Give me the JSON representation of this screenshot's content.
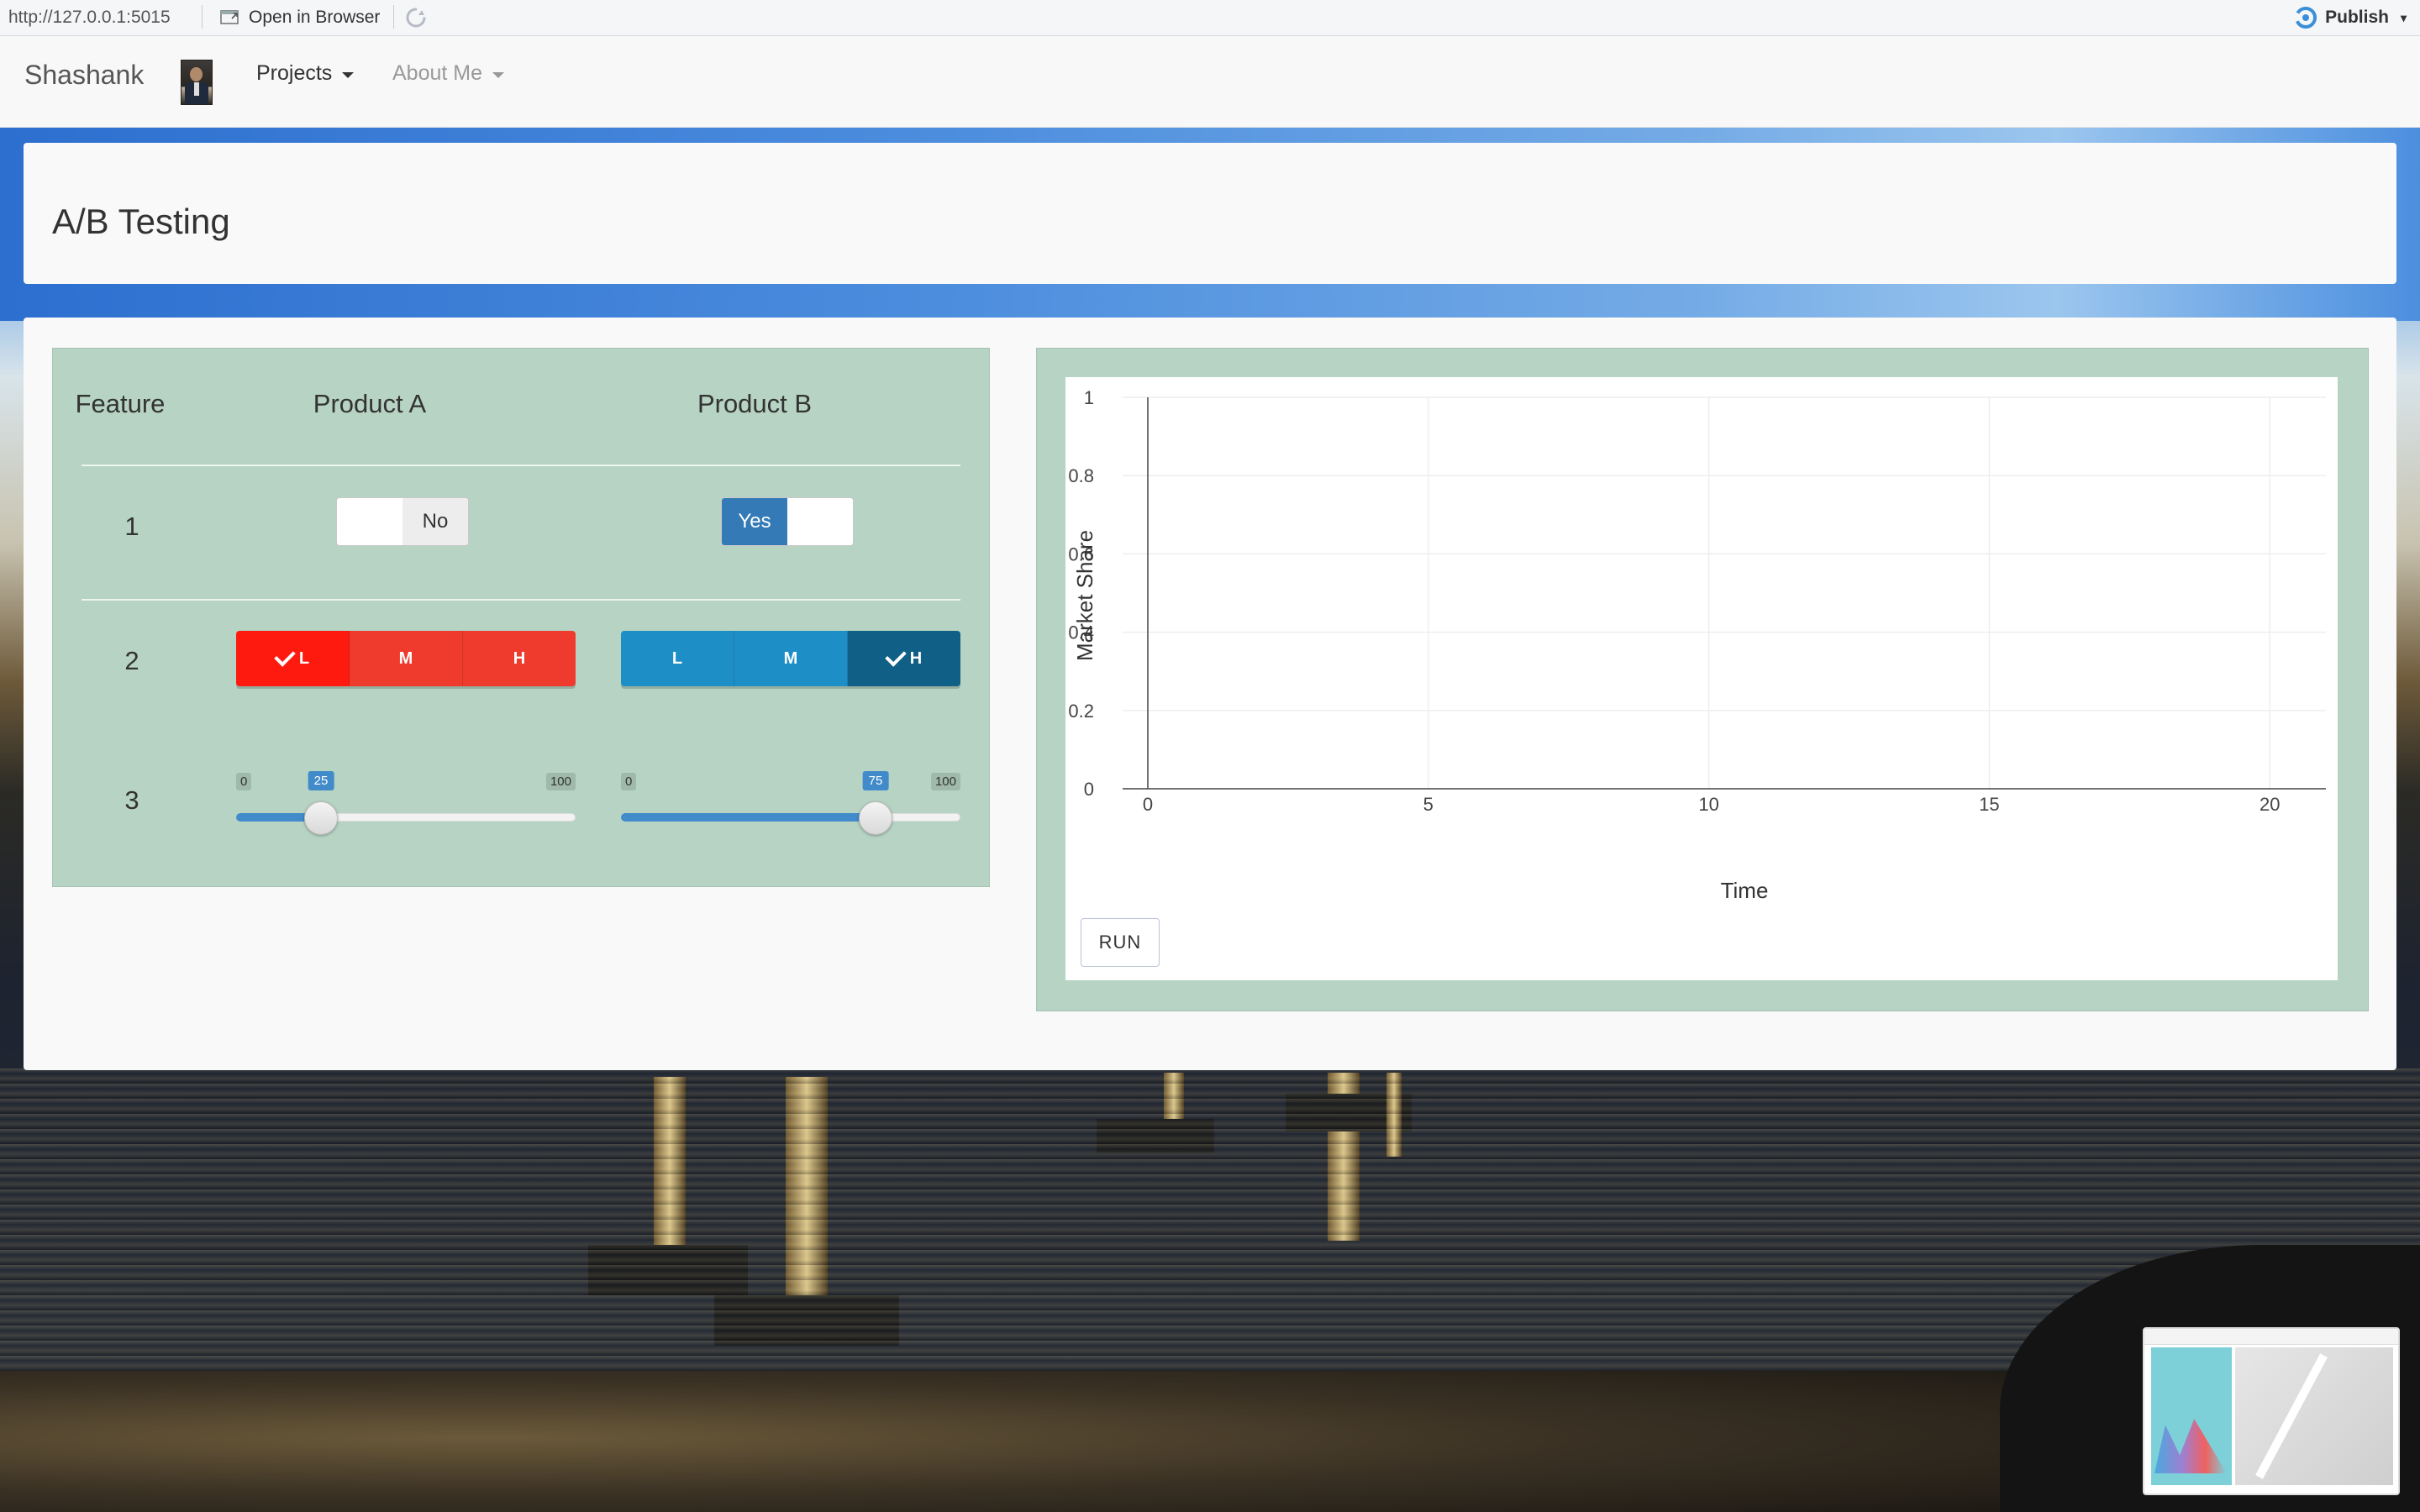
{
  "browser": {
    "url": "http://127.0.0.1:5015",
    "open_in_browser": "Open in Browser",
    "publish": "Publish"
  },
  "navbar": {
    "brand": "Shashank",
    "items": [
      {
        "label": "Projects",
        "active": true
      },
      {
        "label": "About Me",
        "active": false
      }
    ]
  },
  "page": {
    "title": "A/B Testing"
  },
  "features": {
    "headers": [
      "Feature",
      "Product A",
      "Product B"
    ],
    "rows": [
      {
        "number": "1",
        "product_a": {
          "type": "toggle",
          "label": "No",
          "value": false
        },
        "product_b": {
          "type": "toggle",
          "label": "Yes",
          "value": true
        }
      },
      {
        "number": "2",
        "options": [
          "L",
          "M",
          "H"
        ],
        "product_a": {
          "type": "radio",
          "selected": "L",
          "color": "#ef3b2d"
        },
        "product_b": {
          "type": "radio",
          "selected": "H",
          "color": "#1e8fc6"
        }
      },
      {
        "number": "3",
        "product_a": {
          "type": "slider",
          "min": "0",
          "max": "100",
          "value": "25"
        },
        "product_b": {
          "type": "slider",
          "min": "0",
          "max": "100",
          "value": "75"
        }
      }
    ]
  },
  "chart": {
    "run_label": "RUN"
  },
  "chart_data": {
    "type": "line",
    "title": "",
    "xlabel": "Time",
    "ylabel": "Market Share",
    "xlim": [
      0,
      21
    ],
    "ylim": [
      0,
      1
    ],
    "xticks": [
      "0",
      "5",
      "10",
      "15",
      "20"
    ],
    "yticks": [
      "0",
      "0.2",
      "0.4",
      "0.6",
      "0.8",
      "1"
    ],
    "grid": true,
    "series": []
  },
  "colors": {
    "panel_green": "#b6d3c3",
    "red_active": "#ff1a10",
    "blue_active": "#0f5f86",
    "toggle_yes": "#337ab7",
    "slider": "#428bca"
  }
}
